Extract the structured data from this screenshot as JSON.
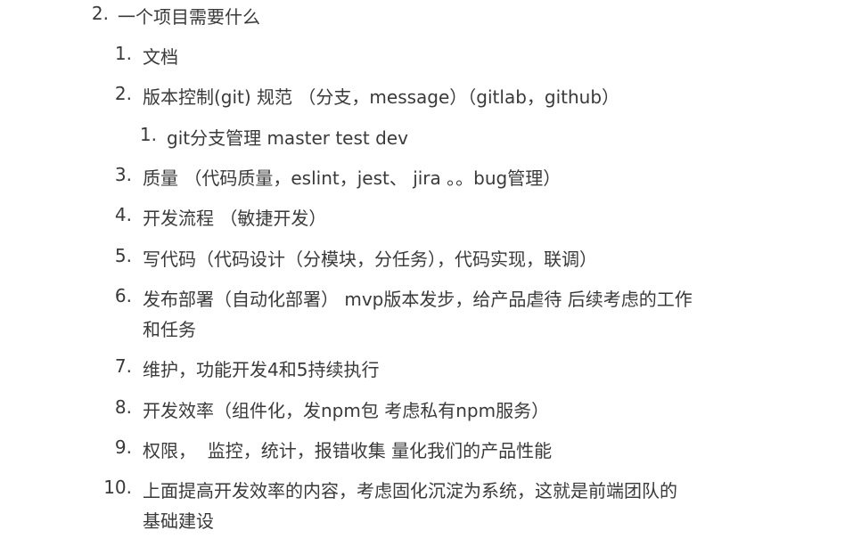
{
  "heading": {
    "number": "2.",
    "text": "一个项目需要什么"
  },
  "items": [
    {
      "number": "1.",
      "text": "文档"
    },
    {
      "number": "2.",
      "text": "版本控制(git) 规范 （分支，message）（gitlab，github）"
    },
    {
      "number": "1.",
      "text": "git分支管理 master test dev"
    },
    {
      "number": "3.",
      "text": "质量 （代码质量，eslint，jest、 jira 。。bug管理）"
    },
    {
      "number": "4.",
      "text": "开发流程 （敏捷开发）"
    },
    {
      "number": "5.",
      "text": "写代码（代码设计（分模块，分任务），代码实现，联调）"
    },
    {
      "number": "6.",
      "text": "发布部署（自动化部署） mvp版本发步，给产品虐待 后续考虑的工作",
      "continuation": "和任务"
    },
    {
      "number": "7.",
      "text": "维护，功能开发4和5持续执行"
    },
    {
      "number": "8.",
      "text": "开发效率（组件化，发npm包 考虑私有npm服务）"
    },
    {
      "number": "9.",
      "text": "权限，  监控，统计，报错收集 量化我们的产品性能"
    },
    {
      "number": "10.",
      "text": "上面提高开发效率的内容，考虑固化沉淀为系统，这就是前端团队的",
      "continuation": "基础建设"
    }
  ]
}
